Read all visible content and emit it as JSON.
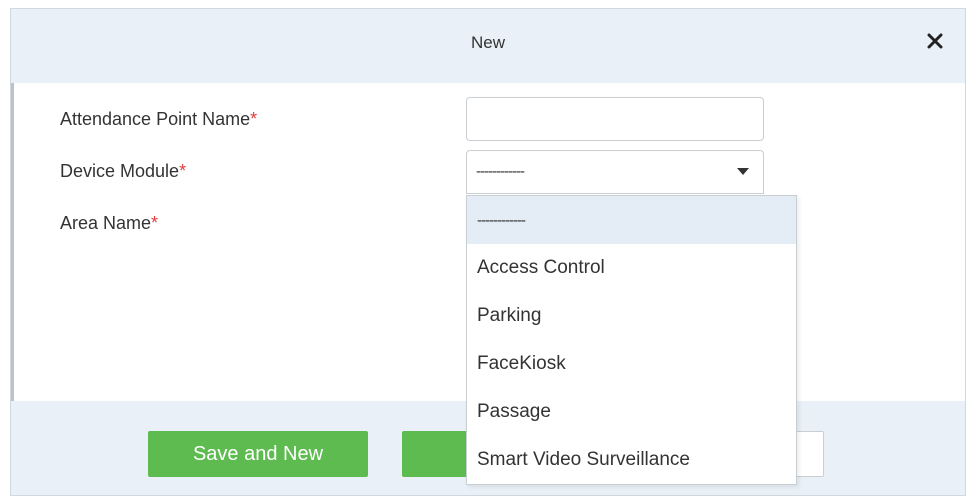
{
  "dialog": {
    "title": "New",
    "close_icon": "close-icon"
  },
  "form": {
    "attendance_point_name": {
      "label": "Attendance Point Name",
      "required_mark": "*",
      "value": ""
    },
    "device_module": {
      "label": "Device Module",
      "required_mark": "*",
      "selected": "------------"
    },
    "area_name": {
      "label": "Area Name",
      "required_mark": "*"
    }
  },
  "dropdown": {
    "options": [
      "------------",
      "Access Control",
      "Parking",
      "FaceKiosk",
      "Passage",
      "Smart Video Surveillance"
    ]
  },
  "footer": {
    "save_and_new_label": "Save and New"
  },
  "colors": {
    "header_bg": "#e9f0f7",
    "required": "#e23b3b",
    "primary_button": "#5dbb50"
  }
}
